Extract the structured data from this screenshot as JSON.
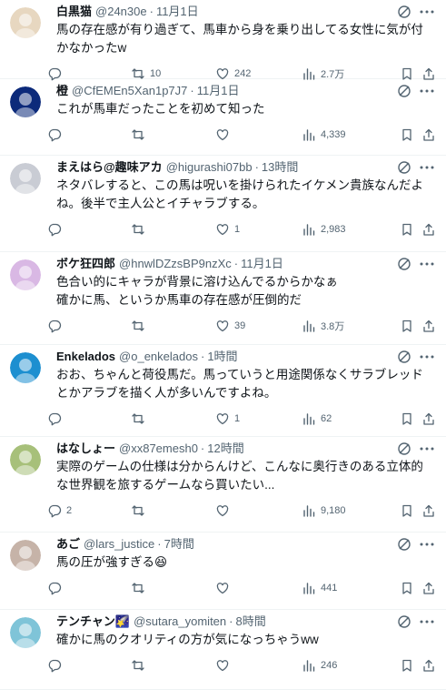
{
  "tweets": [
    {
      "name": "白黒猫",
      "handle": "@24n30e",
      "time": "11月1日",
      "text": "馬の存在感が有り過ぎて、馬車から身を乗り出してる女性に気が付かなかったw",
      "replies": "",
      "retweets": "10",
      "likes": "242",
      "views": "2.7万",
      "avatar": "#e7d7c0"
    },
    {
      "name": "橙",
      "handle": "@CfEMEn5Xan1p7J7",
      "time": "11月1日",
      "text": "これが馬車だったことを初めて知った",
      "replies": "",
      "retweets": "",
      "likes": "",
      "views": "4,339",
      "avatar": "#0c2a7a"
    },
    {
      "name": "まえはら@趣味アカ",
      "handle": "@higurashi07bb",
      "time": "13時間",
      "text": "ネタバレすると、この馬は呪いを掛けられたイケメン貴族なんだよね。後半で主人公とイチャラブする。",
      "replies": "",
      "retweets": "",
      "likes": "1",
      "views": "2,983",
      "avatar": "#c9ccd4"
    },
    {
      "name": "ボケ狂四郎",
      "handle": "@hnwlDZzsBP9nzXc",
      "time": "11月1日",
      "text": "色合い的にキャラが背景に溶け込んでるからかなぁ\n確かに馬、というか馬車の存在感が圧倒的だ",
      "replies": "",
      "retweets": "",
      "likes": "39",
      "views": "3.8万",
      "avatar": "#d9b8e4"
    },
    {
      "name": "Enkelados",
      "handle": "@o_enkelados",
      "time": "1時間",
      "text": "おお、ちゃんと荷役馬だ。馬っていうと用途関係なくサラブレッドとかアラブを描く人が多いんですよね。",
      "replies": "",
      "retweets": "",
      "likes": "1",
      "views": "62",
      "avatar": "#1d8fd0"
    },
    {
      "name": "はなしょー",
      "handle": "@xx87emesh0",
      "time": "12時間",
      "text": "実際のゲームの仕様は分からんけど、こんなに奥行きのある立体的な世界観を旅するゲームなら買いたい...",
      "replies": "2",
      "retweets": "",
      "likes": "",
      "views": "9,180",
      "avatar": "#a7c07a"
    },
    {
      "name": "あご",
      "handle": "@lars_justice",
      "time": "7時間",
      "text": "馬の圧が強すぎる😆",
      "replies": "",
      "retweets": "",
      "likes": "",
      "views": "441",
      "avatar": "#c6b3a8"
    },
    {
      "name": "テンチャン🌠",
      "handle": "@sutara_yomiten",
      "time": "8時間",
      "text": "確かに馬のクオリティの方が気になっちゃうww",
      "replies": "",
      "retweets": "",
      "likes": "",
      "views": "246",
      "avatar": "#7fc4d8"
    }
  ],
  "icons": {
    "reply": "speech-bubble",
    "retweet": "retweet-arrows",
    "like": "heart",
    "views": "bar-chart",
    "bookmark": "bookmark",
    "share": "share-up-arrow",
    "grok": "grok-slash-circle",
    "more": "three-dots"
  },
  "colors": {
    "text": "#0f1419",
    "secondary": "#536471",
    "divider": "#eff3f4"
  }
}
